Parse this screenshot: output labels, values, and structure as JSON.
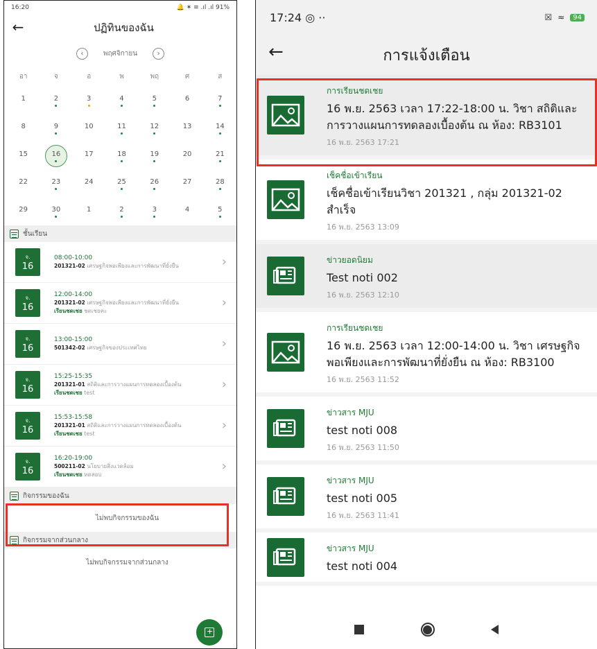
{
  "left": {
    "status_time": "16:20",
    "status_icons": "🔔 ✶ ≡ .ıl .ıl 91%",
    "title": "ปฏิทินของฉัน",
    "month": "พฤศจิกายน",
    "weekdays": [
      "อา",
      "จ",
      "อ",
      "พ",
      "พฤ",
      "ศ",
      "ส"
    ],
    "days": [
      {
        "n": "1",
        "dot": ""
      },
      {
        "n": "2",
        "dot": "g"
      },
      {
        "n": "3",
        "dot": "o"
      },
      {
        "n": "4",
        "dot": "g"
      },
      {
        "n": "5",
        "dot": "g"
      },
      {
        "n": "6",
        "dot": ""
      },
      {
        "n": "7",
        "dot": "g"
      },
      {
        "n": "8",
        "dot": ""
      },
      {
        "n": "9",
        "dot": "g"
      },
      {
        "n": "10",
        "dot": ""
      },
      {
        "n": "11",
        "dot": "g"
      },
      {
        "n": "12",
        "dot": "g"
      },
      {
        "n": "13",
        "dot": ""
      },
      {
        "n": "14",
        "dot": "g"
      },
      {
        "n": "15",
        "dot": ""
      },
      {
        "n": "16",
        "dot": "g",
        "sel": true
      },
      {
        "n": "17",
        "dot": ""
      },
      {
        "n": "18",
        "dot": "g"
      },
      {
        "n": "19",
        "dot": "g"
      },
      {
        "n": "20",
        "dot": ""
      },
      {
        "n": "21",
        "dot": "g"
      },
      {
        "n": "22",
        "dot": ""
      },
      {
        "n": "23",
        "dot": "g"
      },
      {
        "n": "24",
        "dot": ""
      },
      {
        "n": "25",
        "dot": "g"
      },
      {
        "n": "26",
        "dot": "g"
      },
      {
        "n": "27",
        "dot": ""
      },
      {
        "n": "28",
        "dot": "g"
      },
      {
        "n": "29",
        "dot": ""
      },
      {
        "n": "30",
        "dot": "g"
      },
      {
        "n": "1",
        "dot": ""
      },
      {
        "n": "2",
        "dot": "g"
      },
      {
        "n": "3",
        "dot": "g"
      },
      {
        "n": "4",
        "dot": ""
      },
      {
        "n": "5",
        "dot": "g"
      }
    ],
    "section_classes": "ชั้นเรียน",
    "classes": [
      {
        "day": "จ.",
        "date": "16",
        "time": "08:00-10:00",
        "code": "201321-02",
        "name": "เศรษฐกิจพอเพียงและการพัฒนาที่ยั่งยืน",
        "mk": "",
        "note": ""
      },
      {
        "day": "จ.",
        "date": "16",
        "time": "12:00-14:00",
        "code": "201321-02",
        "name": "เศรษฐกิจพอเพียงและการพัฒนาที่ยั่งยืน",
        "mk": "เรียนชดเชย",
        "note": "ชดเชยค่ะ"
      },
      {
        "day": "จ.",
        "date": "16",
        "time": "13:00-15:00",
        "code": "501342-02",
        "name": "เศรษฐกิจของประเทศไทย",
        "mk": "",
        "note": ""
      },
      {
        "day": "จ.",
        "date": "16",
        "time": "15:25-15:35",
        "code": "201321-01",
        "name": "สถิติและการวางแผนการทดลองเบื้องต้น",
        "mk": "เรียนชดเชย",
        "note": "test"
      },
      {
        "day": "จ.",
        "date": "16",
        "time": "15:53-15:58",
        "code": "201321-01",
        "name": "สถิติและการวางแผนการทดลองเบื้องต้น",
        "mk": "เรียนชดเชย",
        "note": "test"
      },
      {
        "day": "จ.",
        "date": "16",
        "time": "16:20-19:00",
        "code": "500211-02",
        "name": "นโยบายสิ่งแวดล้อม",
        "mk": "เรียนชดเชย",
        "note": "ทดสอบ"
      }
    ],
    "section_activities": "กิจกรรมของฉัน",
    "empty_activities": "ไม่พบกิจกรรมของฉัน",
    "section_central": "กิจกรรมจากส่วนกลาง",
    "empty_central": "ไม่พบกิจกรรมจากส่วนกลาง"
  },
  "right": {
    "status_time": "17:24",
    "battery": "94",
    "title": "การแจ้งเตือน",
    "notifications": [
      {
        "icon": "image-icon",
        "cat": "การเรียนชดเชย",
        "msg": "16 พ.ย. 2563 เวลา 17:22-18:00 น. วิชา สถิติและการวางแผนการทดลองเบื้องต้น ณ ห้อง: RB3101",
        "date": "16 พ.ย. 2563 17:21",
        "shade": true
      },
      {
        "icon": "image-icon",
        "cat": "เช็คชื่อเข้าเรียน",
        "msg": "เช็คชื่อเข้าเรียนวิชา 201321 , กลุ่ม 201321-02 สำเร็จ",
        "date": "16 พ.ย. 2563 13:09",
        "shade": false
      },
      {
        "icon": "news-icon",
        "cat": "ข่าวยอดนิยม",
        "msg": "Test noti 002",
        "date": "16 พ.ย. 2563 12:10",
        "shade": true
      },
      {
        "icon": "image-icon",
        "cat": "การเรียนชดเชย",
        "msg": "16 พ.ย. 2563 เวลา 12:00-14:00 น. วิชา เศรษฐกิจพอเพียงและการพัฒนาที่ยั่งยืน ณ ห้อง: RB3100",
        "date": "16 พ.ย. 2563 11:52",
        "shade": false
      },
      {
        "icon": "news-icon",
        "cat": "ข่าวสาร MJU",
        "msg": "test noti 008",
        "date": "16 พ.ย. 2563 11:50",
        "shade": false
      },
      {
        "icon": "news-icon",
        "cat": "ข่าวสาร MJU",
        "msg": "test noti 005",
        "date": "16 พ.ย. 2563 11:41",
        "shade": false
      },
      {
        "icon": "news-icon",
        "cat": "ข่าวสาร MJU",
        "msg": "test noti 004",
        "date": "",
        "shade": false
      }
    ]
  },
  "colors": {
    "green": "#1e6e35",
    "highlight": "#e53224"
  }
}
